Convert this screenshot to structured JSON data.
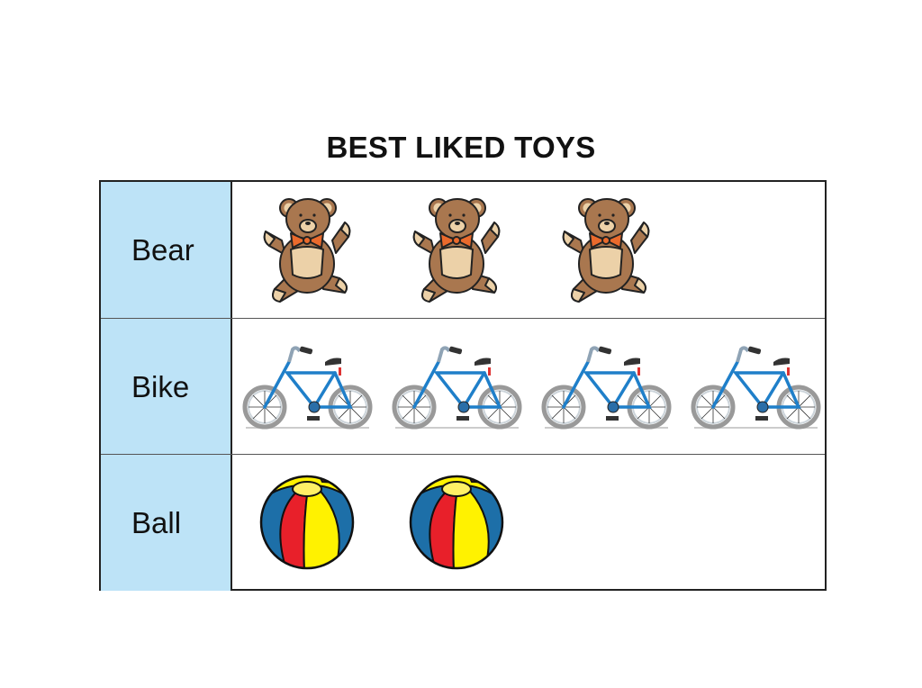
{
  "chart_data": {
    "type": "pictograph",
    "title": "BEST LIKED TOYS",
    "categories": [
      "Bear",
      "Bike",
      "Ball"
    ],
    "values": [
      3,
      4,
      2
    ],
    "icons": [
      "teddy-bear-icon",
      "bicycle-icon",
      "beach-ball-icon"
    ],
    "label_column_color": "#bde3f7"
  }
}
